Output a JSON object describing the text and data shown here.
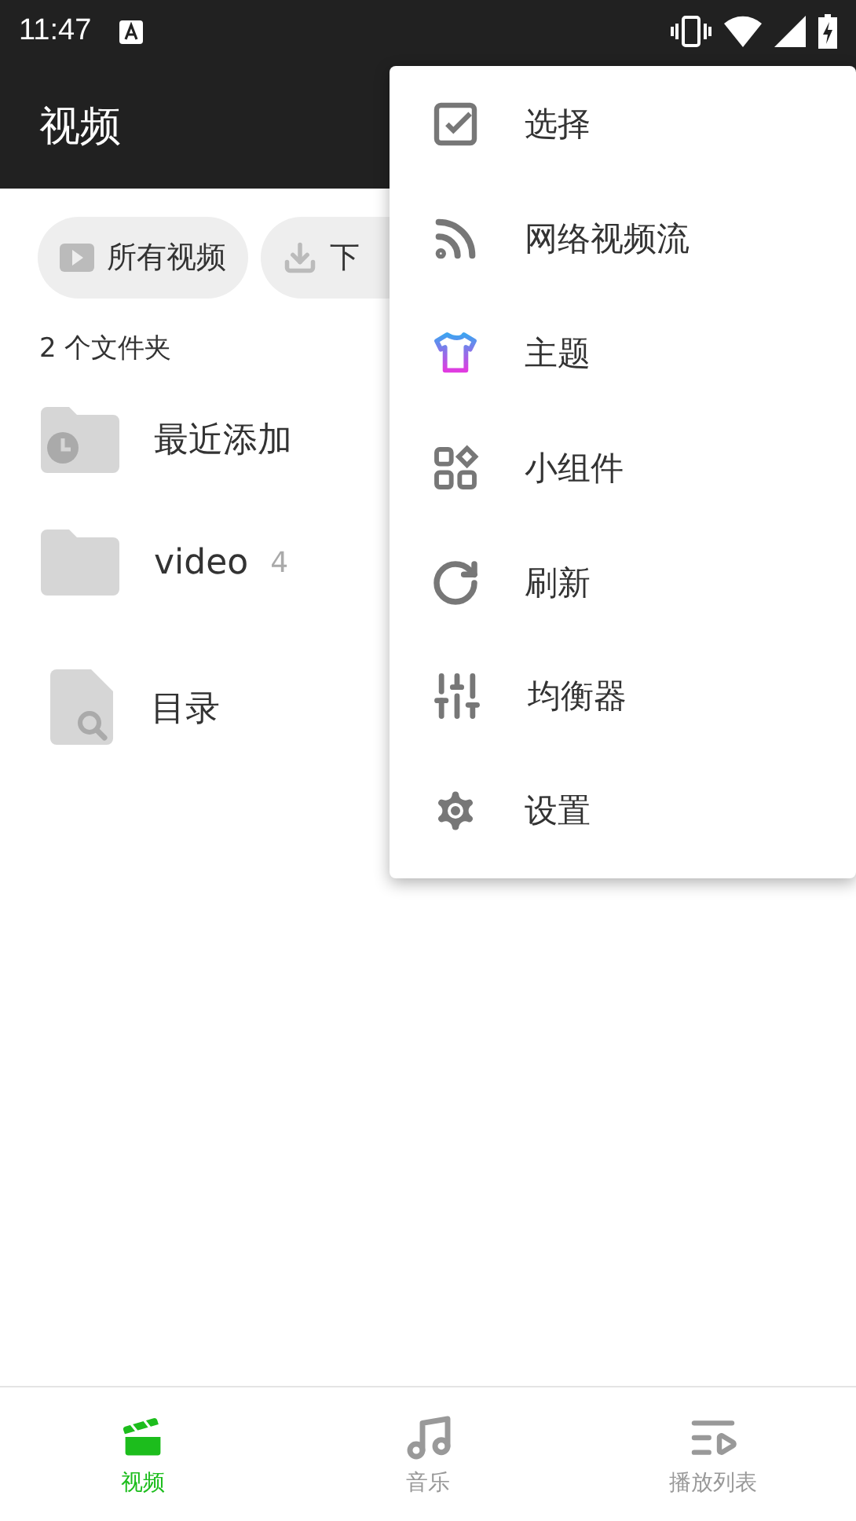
{
  "status_bar": {
    "time": "11:47"
  },
  "toolbar": {
    "title": "视频"
  },
  "chips": [
    {
      "kind": "play",
      "label": "所有视频"
    },
    {
      "kind": "download",
      "label": "下"
    }
  ],
  "folder_count": "2 个文件夹",
  "items": [
    {
      "kind": "recent",
      "name": "最近添加"
    },
    {
      "kind": "folder",
      "name": "video",
      "count": "4"
    },
    {
      "kind": "browse",
      "name": "目录"
    }
  ],
  "menu": [
    {
      "kind": "select",
      "label": "选择"
    },
    {
      "kind": "stream",
      "label": "网络视频流"
    },
    {
      "kind": "theme",
      "label": "主题"
    },
    {
      "kind": "widgets",
      "label": "小组件"
    },
    {
      "kind": "refresh",
      "label": "刷新"
    },
    {
      "kind": "equalizer",
      "label": "均衡器"
    },
    {
      "kind": "settings",
      "label": "设置"
    }
  ],
  "bottom_nav": [
    {
      "kind": "video",
      "label": "视频",
      "selected": true
    },
    {
      "kind": "music",
      "label": "音乐",
      "selected": false
    },
    {
      "kind": "playlist",
      "label": "播放列表",
      "selected": false
    }
  ]
}
